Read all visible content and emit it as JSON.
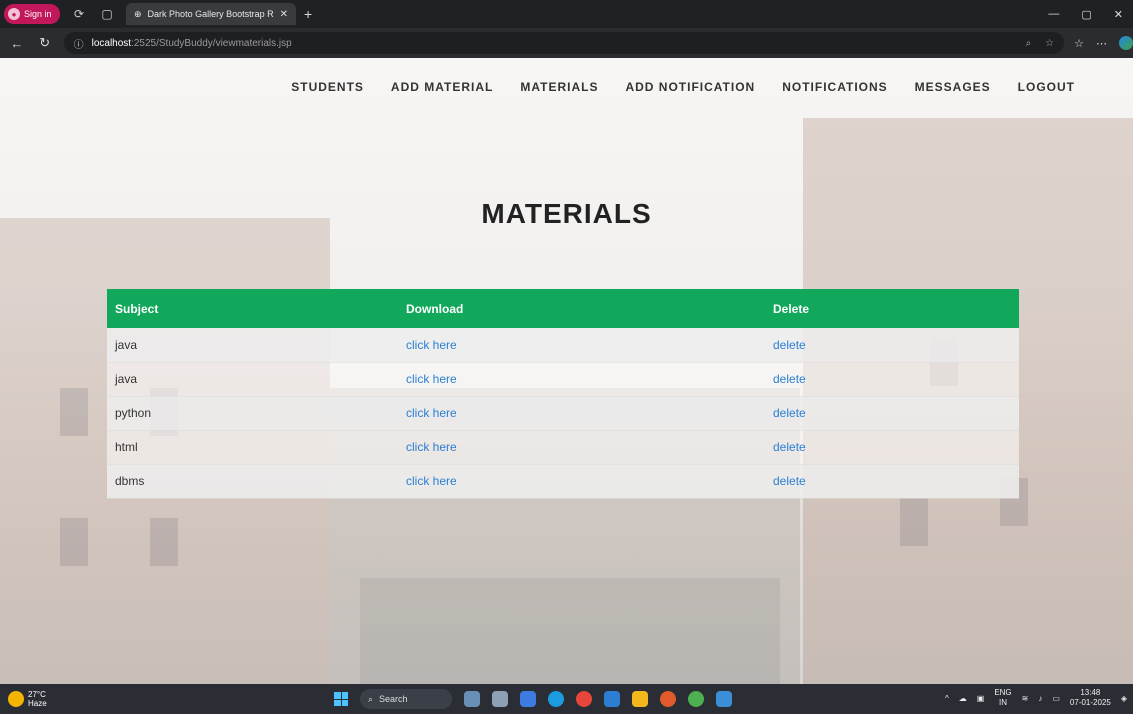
{
  "browser": {
    "profile_label": "Sign in",
    "tab_title": "Dark Photo Gallery Bootstrap Re",
    "url_host": "localhost",
    "url_path": ":2525/StudyBuddy/viewmaterials.jsp"
  },
  "nav": {
    "items": [
      "STUDENTS",
      "ADD MATERIAL",
      "MATERIALS",
      "ADD NOTIFICATION",
      "NOTIFICATIONS",
      "MESSAGES",
      "LOGOUT"
    ]
  },
  "page": {
    "title": "MATERIALS"
  },
  "table": {
    "headers": [
      "Subject",
      "Download",
      "Delete"
    ],
    "rows": [
      {
        "subject": "java",
        "download": "click here",
        "delete": "delete"
      },
      {
        "subject": "java",
        "download": "click here",
        "delete": "delete"
      },
      {
        "subject": "python",
        "download": "click here",
        "delete": "delete"
      },
      {
        "subject": "html",
        "download": "click here",
        "delete": "delete"
      },
      {
        "subject": "dbms",
        "download": "click here",
        "delete": "delete"
      }
    ]
  },
  "taskbar": {
    "weather_temp": "27°C",
    "weather_desc": "Haze",
    "search_label": "Search",
    "lang_top": "ENG",
    "lang_bottom": "IN",
    "time": "13:48",
    "date": "07-01-2025"
  },
  "colors": {
    "header_green": "#11a85b",
    "link_blue": "#2a7fd3"
  }
}
